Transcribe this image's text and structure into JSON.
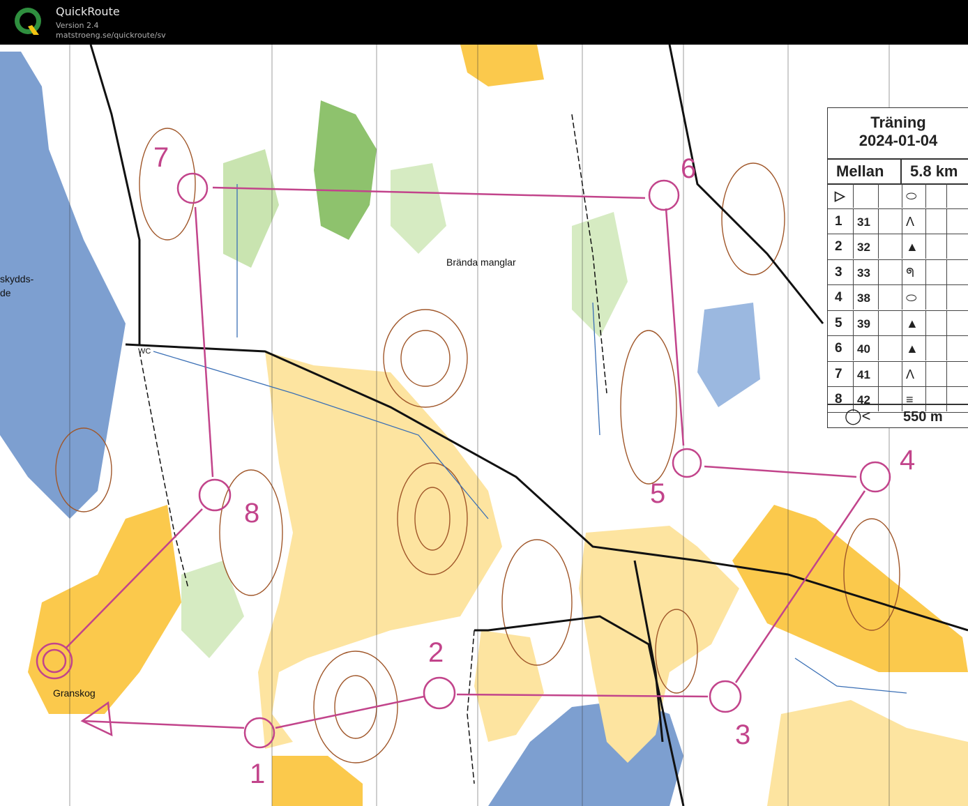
{
  "app": {
    "title": "QuickRoute",
    "version": "Version 2.4",
    "url": "matstroeng.se/quickroute/sv",
    "logo_letter": "Q"
  },
  "colors": {
    "course": "#c2448b",
    "water": "#7d9fd0",
    "open_land": "#fbc94c",
    "rough_open": "#fde4a0",
    "vegetation": "#aed38e",
    "contour": "#a0572a",
    "road": "#111111"
  },
  "legend": {
    "title": "Träning",
    "date": "2024-01-04",
    "class_name": "Mellan",
    "length": "5.8 km",
    "rows": [
      {
        "num": "1",
        "code": "31",
        "symbol": "Ʌ"
      },
      {
        "num": "2",
        "code": "32",
        "symbol": "▲"
      },
      {
        "num": "3",
        "code": "33",
        "symbol": "ᖗ"
      },
      {
        "num": "4",
        "code": "38",
        "symbol": "⬭"
      },
      {
        "num": "5",
        "code": "39",
        "symbol": "▲"
      },
      {
        "num": "6",
        "code": "40",
        "symbol": "▲"
      },
      {
        "num": "7",
        "code": "41",
        "symbol": "Ʌ"
      },
      {
        "num": "8",
        "code": "42",
        "symbol": "≡"
      }
    ],
    "start_symbol": "▷",
    "start_feature": "⬭",
    "finish_distance": "550 m"
  },
  "map_labels": {
    "place_1": "Brända manglar",
    "place_2": "Granskog",
    "place_3": "skydds-",
    "place_4": "de",
    "wc": "WC"
  },
  "controls": [
    {
      "num": "1"
    },
    {
      "num": "2"
    },
    {
      "num": "3"
    },
    {
      "num": "4"
    },
    {
      "num": "5"
    },
    {
      "num": "6"
    },
    {
      "num": "7"
    },
    {
      "num": "8"
    }
  ]
}
